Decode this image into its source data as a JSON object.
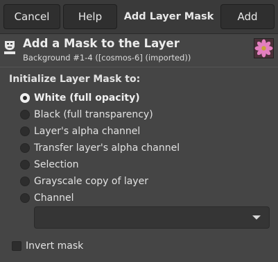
{
  "header": {
    "cancel_label": "Cancel",
    "help_label": "Help",
    "title": "Add Layer Mask",
    "add_label": "Add"
  },
  "dialog": {
    "title": "Add a Mask to the Layer",
    "subtitle": "Background #1-4 ([cosmos-6] (imported))",
    "icon": "layer-mask-icon"
  },
  "init_section": {
    "label": "Initialize Layer Mask to:",
    "selected": "White (full opacity)",
    "options": [
      "White (full opacity)",
      "Black (full transparency)",
      "Layer's alpha channel",
      "Transfer layer's alpha channel",
      "Selection",
      "Grayscale copy of layer",
      "Channel"
    ]
  },
  "channel_dropdown": {
    "value": ""
  },
  "invert": {
    "label": "Invert mask",
    "checked": false
  },
  "colors": {
    "background": "#454545",
    "header": "#3a3a3a",
    "button": "#2f2f2f",
    "text": "#e2e2e2"
  }
}
